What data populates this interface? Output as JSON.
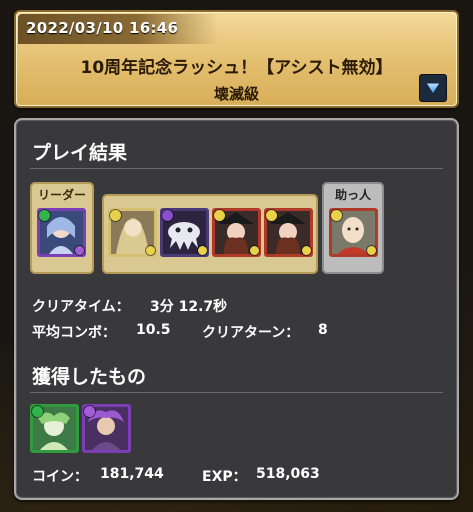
{
  "header": {
    "datetime": "2022/03/10 16:46",
    "dungeon_title": "10周年記念ラッシュ！【アシスト無効】",
    "difficulty": "壊滅級",
    "menu_icon": "triangle-down-icon"
  },
  "result": {
    "section_title": "プレイ結果",
    "leader_tag": "リーダー",
    "helper_tag": "助っ人",
    "clear_time_label": "クリアタイム：",
    "clear_time_value": "3分 12.7秒",
    "avg_combo_label": "平均コンボ：",
    "avg_combo_value": "10.5",
    "clear_turn_label": "クリアターン：",
    "clear_turn_value": "8"
  },
  "team": {
    "leader": {
      "icon": "leader-monster-icon",
      "frame_color": "#7a3fb5",
      "orb_color": "#2fb54a",
      "sub_orb_color": "#a35bd6"
    },
    "subs": [
      {
        "icon": "sub1-monster-icon",
        "frame_color": "#d4c070",
        "orb_color": "#e8d24a",
        "sub_orb_color": "#e8d24a"
      },
      {
        "icon": "sub2-monster-icon",
        "frame_color": "#4a3a78",
        "orb_color": "#8a4fcc",
        "sub_orb_color": "#e8d24a"
      },
      {
        "icon": "sub3-monster-icon",
        "frame_color": "#b03a2a",
        "orb_color": "#e8d24a",
        "sub_orb_color": "#e8d24a"
      },
      {
        "icon": "sub4-monster-icon",
        "frame_color": "#b03a2a",
        "orb_color": "#e8d24a",
        "sub_orb_color": "#e8d24a"
      }
    ],
    "helper": {
      "icon": "helper-monster-icon",
      "frame_color": "#b03a2a",
      "orb_color": "#e8d24a",
      "sub_orb_color": "#e8d24a"
    }
  },
  "rewards": {
    "section_title": "獲得したもの",
    "items": [
      {
        "icon": "reward1-monster-icon",
        "frame_color": "#2f9b3e",
        "orb_color": "#2fb54a"
      },
      {
        "icon": "reward2-monster-icon",
        "frame_color": "#7a3fb5",
        "orb_color": "#a35bd6"
      }
    ],
    "coin_label": "コイン：",
    "coin_value": "181,744",
    "exp_label": "EXP：",
    "exp_value": "518,063"
  }
}
